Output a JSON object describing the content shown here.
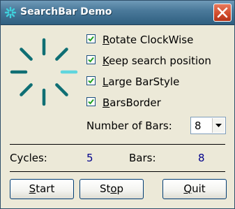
{
  "window": {
    "title": "SearchBar Demo",
    "icon": "searchbar-app-icon",
    "close_icon": "close-icon",
    "accent": "#1f9aa0"
  },
  "spinner": {
    "bars": 8,
    "active_bar_color": "#5fd6de",
    "bar_color": "#0f6f74"
  },
  "options": [
    {
      "label_prefix": "",
      "hotkey": "R",
      "label_rest": "otate ClockWise",
      "checked": true
    },
    {
      "label_prefix": "",
      "hotkey": "K",
      "label_rest": "eep search position",
      "checked": true
    },
    {
      "label_prefix": "",
      "hotkey": "L",
      "label_rest": "arge BarStyle",
      "checked": true
    },
    {
      "label_prefix": "",
      "hotkey": "B",
      "label_rest": "arsBorder",
      "checked": true
    }
  ],
  "num_bars": {
    "label": "Number of Bars:",
    "value": "8"
  },
  "stats": {
    "cycles_label": "Cycles:",
    "cycles_value": "5",
    "bars_label": "Bars:",
    "bars_value": "8"
  },
  "buttons": {
    "start": {
      "hotkey": "S",
      "rest": "tart"
    },
    "stop": {
      "pre": "St",
      "hotkey": "o",
      "rest": "p"
    },
    "quit": {
      "hotkey": "Q",
      "rest": "uit"
    }
  }
}
